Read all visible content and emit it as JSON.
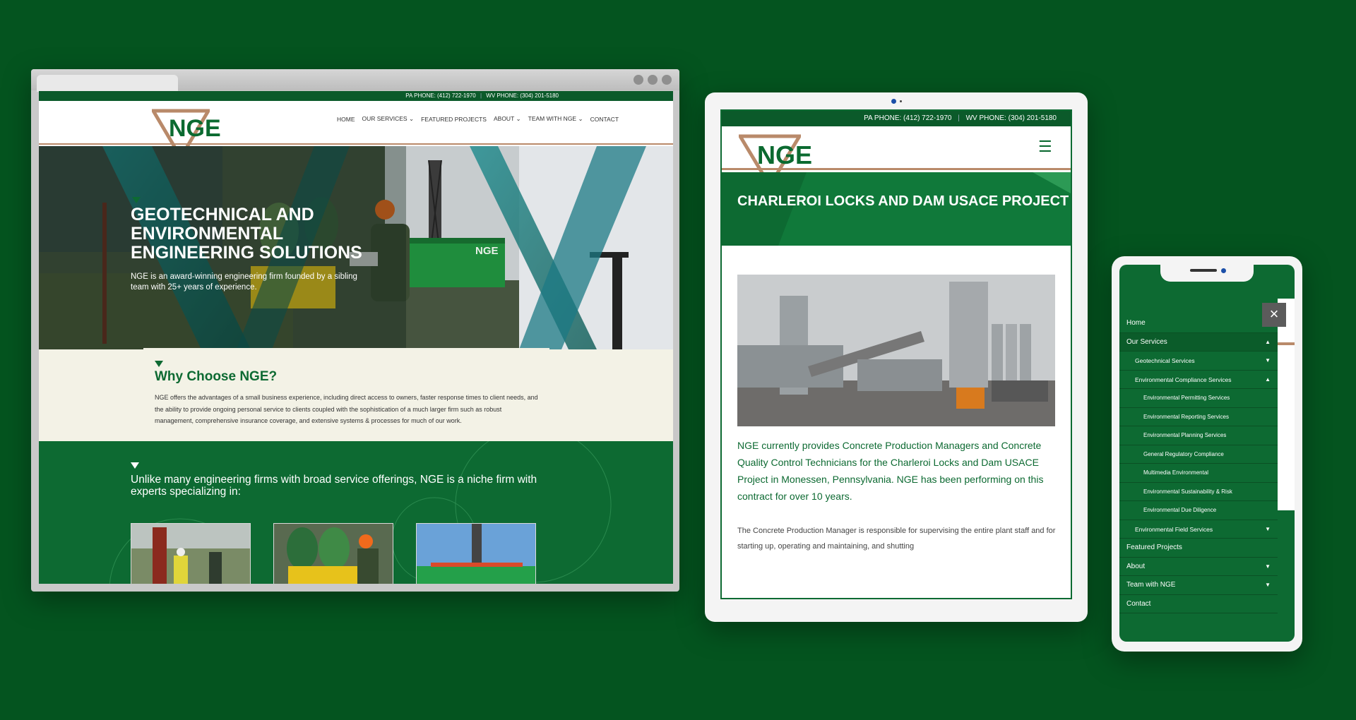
{
  "desktop": {
    "topbar": {
      "pa": "PA PHONE: (412) 722-1970",
      "wv": "WV PHONE: (304) 201-5180"
    },
    "logo": "NGE",
    "nav": [
      {
        "label": "HOME",
        "chevron": false
      },
      {
        "label": "OUR SERVICES",
        "chevron": true
      },
      {
        "label": "FEATURED PROJECTS",
        "chevron": false
      },
      {
        "label": "ABOUT",
        "chevron": true
      },
      {
        "label": "TEAM WITH NGE",
        "chevron": true
      },
      {
        "label": "CONTACT",
        "chevron": false
      }
    ],
    "hero": {
      "title": "GEOTECHNICAL AND ENVIRONMENTAL ENGINEERING SOLUTIONS",
      "subtitle": "NGE is an award-winning engineering firm founded by a sibling team with 25+ years of experience.",
      "dumpster_logo": "NGE"
    },
    "why": {
      "heading": "Why Choose NGE?",
      "body": "NGE offers the advantages of a small business experience, including direct access to owners, faster response times to client needs, and the ability to provide ongoing personal service to clients coupled with the sophistication of a much larger firm such as robust management, comprehensive insurance coverage, and extensive systems & processes for much of our work."
    },
    "niche": {
      "text": "Unlike many engineering firms with broad service offerings, NGE is a niche firm with experts specializing in:"
    }
  },
  "tablet": {
    "topbar": {
      "pa": "PA PHONE: (412) 722-1970",
      "wv": "WV PHONE: (304) 201-5180"
    },
    "logo": "NGE",
    "title": "CHARLEROI LOCKS AND DAM USACE PROJECT",
    "lead": "NGE currently provides Concrete Production Managers and Concrete Quality Control Technicians for the Charleroi Locks and Dam USACE Project in Monessen, Pennsylvania.  NGE has been performing on this contract for over 10 years.",
    "body": "The Concrete Production Manager is responsible for supervising the entire plant staff and for starting up, operating and maintaining, and shutting"
  },
  "phone": {
    "menu": [
      {
        "label": "Home",
        "level": 0,
        "arrow": ""
      },
      {
        "label": "Our Services",
        "level": 0,
        "arrow": "▲"
      },
      {
        "label": "Geotechnical Services",
        "level": 1,
        "arrow": "▼"
      },
      {
        "label": "Environmental Compliance Services",
        "level": 1,
        "arrow": "▲"
      },
      {
        "label": "Environmental Permitting Services",
        "level": 2,
        "arrow": ""
      },
      {
        "label": "Environmental Reporting Services",
        "level": 2,
        "arrow": ""
      },
      {
        "label": "Environmental Planning Services",
        "level": 2,
        "arrow": ""
      },
      {
        "label": "General Regulatory Compliance",
        "level": 2,
        "arrow": ""
      },
      {
        "label": "Multimedia Environmental",
        "level": 2,
        "arrow": ""
      },
      {
        "label": "Environmental Sustainability & Risk",
        "level": 2,
        "arrow": ""
      },
      {
        "label": "Environmental Due Diligence",
        "level": 2,
        "arrow": ""
      },
      {
        "label": "Environmental Field Services",
        "level": 1,
        "arrow": "▼"
      },
      {
        "label": "Featured Projects",
        "level": 0,
        "arrow": ""
      },
      {
        "label": "About",
        "level": 0,
        "arrow": "▼"
      },
      {
        "label": "Team with NGE",
        "level": 0,
        "arrow": "▼"
      },
      {
        "label": "Contact",
        "level": 0,
        "arrow": ""
      }
    ],
    "close": "×"
  },
  "colors": {
    "brand_green": "#0d6a32",
    "background": "#04541f",
    "accent_copper": "#b98a6a",
    "cream": "#f3f2e6"
  }
}
